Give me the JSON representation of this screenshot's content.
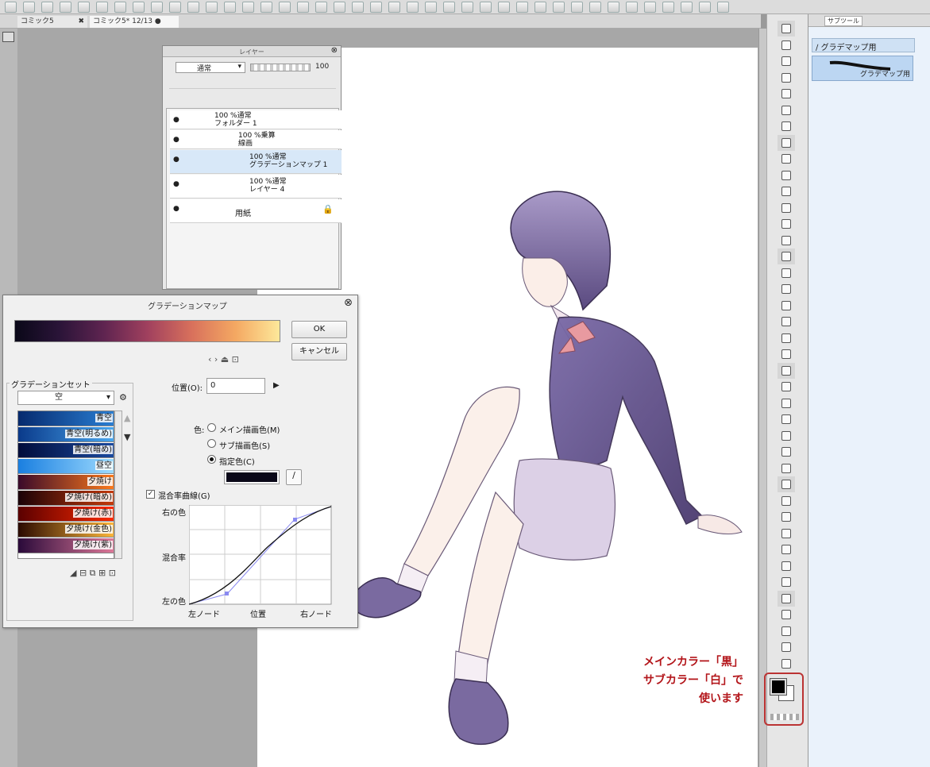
{
  "tabs": [
    {
      "label": "コミック5"
    },
    {
      "label": "コミック5* 12/13 ●"
    }
  ],
  "layer_panel": {
    "title": "レイヤー",
    "blend_mode": "通常",
    "opacity": "100",
    "layers": [
      {
        "opacity": "100 %通常",
        "name": "フォルダー 1"
      },
      {
        "opacity": "100 %乗算",
        "name": "線画"
      },
      {
        "opacity": "100 %通常",
        "name": "グラデーションマップ 1"
      },
      {
        "opacity": "100 %通常",
        "name": "レイヤー 4"
      },
      {
        "opacity": "",
        "name": "用紙"
      }
    ]
  },
  "grad_dialog": {
    "title": "グラデーションマップ",
    "ok": "OK",
    "cancel": "キャンセル",
    "set_group": "グラデーションセット",
    "set_selected": "空",
    "sets": [
      {
        "label": "青空",
        "colors": [
          "#062a6e",
          "#2a7fd4"
        ]
      },
      {
        "label": "青空(明るめ)",
        "colors": [
          "#0a3a8a",
          "#4aa8f0"
        ]
      },
      {
        "label": "青空(暗め)",
        "colors": [
          "#020c3a",
          "#1a4aa0"
        ]
      },
      {
        "label": "昼空",
        "colors": [
          "#1a7fe0",
          "#9fdcff"
        ]
      },
      {
        "label": "夕焼け",
        "colors": [
          "#3a0a2a",
          "#ff7a1a"
        ]
      },
      {
        "label": "夕焼け(暗め)",
        "colors": [
          "#1a0208",
          "#c83a0a"
        ]
      },
      {
        "label": "夕焼け(赤)",
        "colors": [
          "#5a0000",
          "#ff2a00"
        ]
      },
      {
        "label": "夕焼け(金色)",
        "colors": [
          "#2a0a00",
          "#ffb83a"
        ]
      },
      {
        "label": "夕焼け(紫)",
        "colors": [
          "#2a0a3a",
          "#e07a9a"
        ]
      }
    ],
    "position_label": "位置(O):",
    "position_value": "0",
    "color_label": "色:",
    "radio_main": "メイン描画色(M)",
    "radio_sub": "サブ描画色(S)",
    "radio_spec": "指定色(C)",
    "curve_label": "混合率曲線(G)",
    "right_color": "右の色",
    "mix_rate": "混合率",
    "left_color": "左の色",
    "left_node": "左ノード",
    "position": "位置",
    "right_node": "右ノード",
    "gradient_colors": [
      "#0a0818",
      "#2a1438",
      "#5e2450",
      "#a0405e",
      "#d8705c",
      "#f4a862",
      "#fde89a"
    ]
  },
  "subtool": {
    "tab": "サブツール",
    "group": "グラデマップ用",
    "item": "グラデマップ用"
  },
  "note": {
    "line1": "メインカラー「黒」",
    "line2": "サブカラー「白」で",
    "line3": "使います"
  },
  "colors": {
    "main": "#000000",
    "sub": "#ffffff",
    "accent": "#b3151a"
  }
}
